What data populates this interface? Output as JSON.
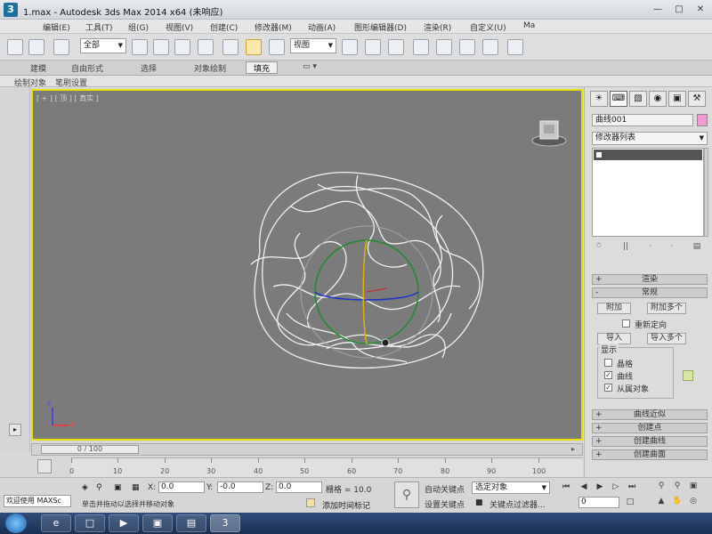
{
  "window": {
    "title": "1.max - Autodesk 3ds Max  2014 x64     (未响应)",
    "logo": "3"
  },
  "menu": [
    "编辑(E)",
    "工具(T)",
    "组(G)",
    "视图(V)",
    "创建(C)",
    "修改器(M)",
    "动画(A)",
    "图形编辑器(D)",
    "渲染(R)",
    "自定义(U)",
    "Ma"
  ],
  "toolbar": {
    "selection_filter": "全部",
    "ref_coord": "视图"
  },
  "ribbon": {
    "tabs": [
      "建模",
      "自由形式",
      "选择",
      "对象绘制",
      "填充"
    ],
    "active_tab": "填充",
    "sub": [
      "绘制对象",
      "笔刷设置"
    ]
  },
  "viewport": {
    "label": "[ + ] [ 顶 ] [ 真实 ]",
    "axis_z": "z",
    "axis_x": "x"
  },
  "command_panel": {
    "tabs": [
      "create-icon",
      "modify-icon",
      "hierarchy-icon",
      "motion-icon",
      "display-icon",
      "utilities-icon"
    ],
    "object_name": "曲线001",
    "object_color": "#f39ad3",
    "modifier_list": "修改器列表",
    "rollouts": {
      "render": "渲染",
      "general": "常规",
      "curve_approx": "曲线近似",
      "create_points": "创建点",
      "create_curves": "创建曲线",
      "create_surfaces": "创建曲面"
    },
    "buttons": {
      "attach": "附加",
      "attach_multiple": "附加多个",
      "reorient": "重新定向",
      "import": "导入",
      "import_multiple": "导入多个"
    },
    "display": {
      "title": "显示",
      "lattices": "晶格",
      "curves": "曲线",
      "dependents": "从属对象"
    }
  },
  "timeline": {
    "frame": "0 / 100",
    "ticks": [
      "0",
      "10",
      "20",
      "30",
      "40",
      "50",
      "60",
      "70",
      "80",
      "90",
      "100"
    ]
  },
  "status": {
    "maxscript": "欢迎使用 MAXSc",
    "prompt": "单击并拖动以选择并移动对象",
    "x_label": "X:",
    "y_label": "Y:",
    "z_label": "Z:",
    "x": "0.0",
    "y": "-0.0",
    "z": "0.0",
    "grid": "栅格 = 10.0",
    "add_time_tag": "添加时间标记",
    "auto_key": "自动关键点",
    "set_key": "设置关键点",
    "selection_set": "选定对象",
    "key_filters": "关键点过滤器...",
    "current_frame": "0"
  }
}
